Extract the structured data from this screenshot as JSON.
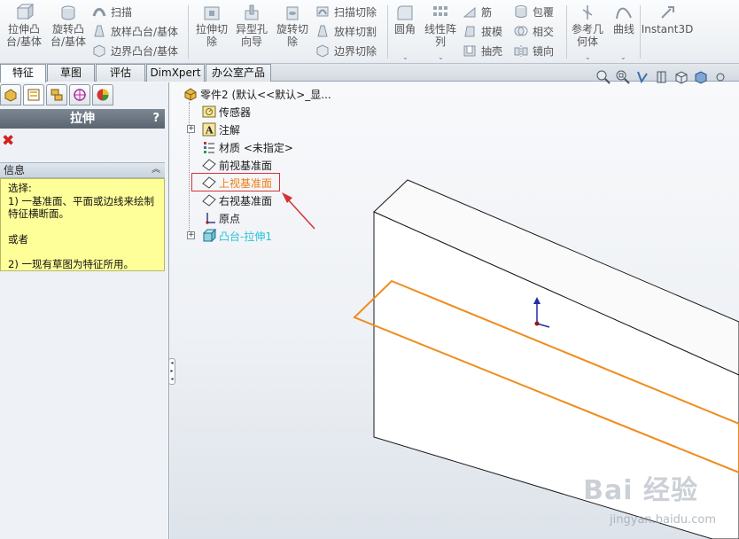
{
  "toolbar": {
    "extrude_boss": "拉伸凸\n台/基体",
    "revolve_boss": "旋转凸\n台/基体",
    "sweep": "扫描",
    "loft": "放样凸台/基体",
    "boundary_boss": "边界凸台/基体",
    "extrude_cut": "拉伸切\n除",
    "hole_wizard": "异型孔\n向导",
    "revolve_cut": "旋转切\n除",
    "swept_cut": "扫描切除",
    "lofted_cut": "放样切割",
    "boundary_cut": "边界切除",
    "fillet": "圆角",
    "linear_pattern": "线性阵\n列",
    "rib": "筋",
    "draft": "拔模",
    "shell": "抽壳",
    "wrap": "包覆",
    "intersect": "相交",
    "mirror": "镜向",
    "reference_geometry": "参考几\n何体",
    "curves": "曲线",
    "instant3d": "Instant3D"
  },
  "tabs": [
    "特征",
    "草图",
    "评估",
    "DimXpert",
    "办公室产品"
  ],
  "active_tab": "特征",
  "property_manager": {
    "title": "拉伸",
    "help": "?",
    "cancel_icon": "close-icon",
    "info_header": "信息",
    "info_lines": [
      "选择:",
      "1) 一基准面、平面或边线来绘制特征横断面。",
      "或者",
      "2) 一现有草图为特征所用。"
    ]
  },
  "feature_tree": {
    "root": "零件2  (默认<<默认>_显...",
    "items": [
      {
        "label": "传感器",
        "icon": "sensor-icon"
      },
      {
        "label": "注解",
        "icon": "annotation-icon",
        "expandable": true
      },
      {
        "label": "材质 <未指定>",
        "icon": "material-icon"
      },
      {
        "label": "前视基准面",
        "icon": "plane-icon"
      },
      {
        "label": "上视基准面",
        "icon": "plane-icon",
        "highlighted": true
      },
      {
        "label": "右视基准面",
        "icon": "plane-icon"
      },
      {
        "label": "原点",
        "icon": "origin-icon"
      },
      {
        "label": "凸台-拉伸1",
        "icon": "extrude-feature-icon",
        "expandable": true
      }
    ]
  },
  "colors": {
    "highlight_text": "#f07d14",
    "feature_text": "#23c4d8",
    "annotation_box": "#d33434",
    "plane_outline": "#f08c1e",
    "origin_arrow": "#1f2ea6"
  },
  "watermark": {
    "logo": "Bai 经验",
    "url": "jingyan.baidu.com"
  }
}
